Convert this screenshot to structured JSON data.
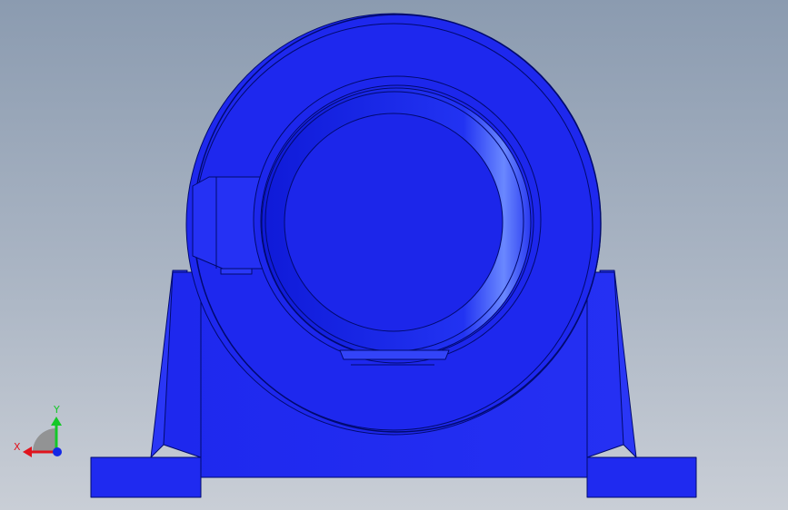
{
  "viewport": {
    "background_top": "#8b9bb0",
    "background_bottom": "#c9ced6"
  },
  "part": {
    "name": "pillow-block-bearing-housing",
    "view": "front",
    "color": "#1f2af0",
    "edge_color": "#000a6e",
    "highlight": "#5a78ff"
  },
  "triad": {
    "x_label": "X",
    "y_label": "Y",
    "x_color": "#e0141e",
    "y_color": "#14c828",
    "z_color": "#1428e6"
  }
}
